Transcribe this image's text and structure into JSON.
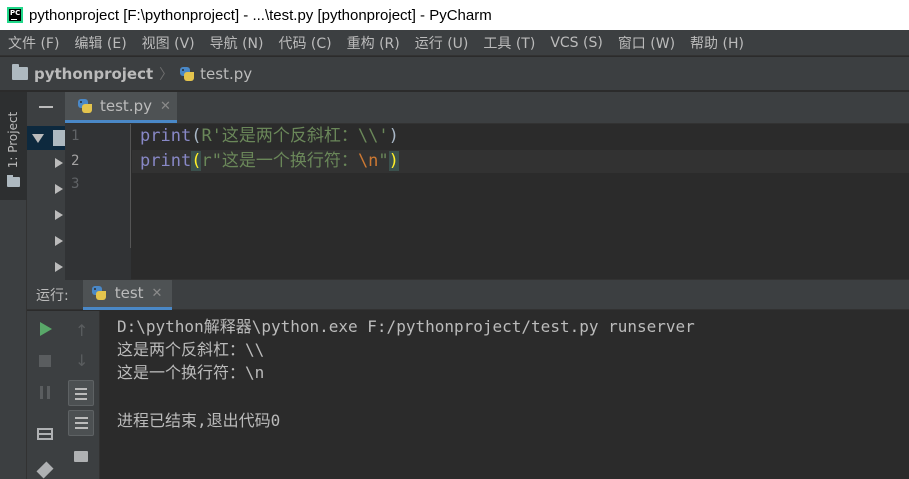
{
  "window": {
    "title": "pythonproject [F:\\pythonproject] - ...\\test.py [pythonproject] - PyCharm"
  },
  "menu": [
    "文件 (F)",
    "编辑 (E)",
    "视图 (V)",
    "导航 (N)",
    "代码 (C)",
    "重构 (R)",
    "运行 (U)",
    "工具 (T)",
    "VCS (S)",
    "窗口 (W)",
    "帮助 (H)"
  ],
  "navbar": {
    "project": "pythonproject",
    "file": "test.py"
  },
  "left_strip": {
    "project_tab": "1: Project"
  },
  "editor": {
    "tab_label": "test.py",
    "line_numbers": [
      "1",
      "2",
      "3"
    ],
    "lines": [
      {
        "func": "print",
        "open": "(",
        "string": "R'这是两个反斜杠：\\\\'",
        "close": ")"
      },
      {
        "func": "print",
        "open": "(",
        "prefix": "r",
        "string_a": "\"这是一个换行符：",
        "escape": "\\n",
        "string_b": "\"",
        "close": ")"
      }
    ]
  },
  "run_panel": {
    "label": "运行:",
    "tab_label": "test",
    "console_lines": [
      "D:\\python解释器\\python.exe F:/pythonproject/test.py runserver",
      "这是两个反斜杠：\\\\",
      "这是一个换行符：\\n",
      "",
      "进程已结束,退出代码0"
    ]
  },
  "icons": {
    "app": "pycharm-app-icon",
    "folder": "folder-icon",
    "python_file": "python-file-icon",
    "run": "play-icon",
    "stop": "stop-icon",
    "pause": "pause-icon"
  },
  "colors": {
    "run_green": "#59a869",
    "tab_underline": "#4a88c7",
    "string_green": "#6a8759",
    "builtin_purple": "#8888c6"
  }
}
